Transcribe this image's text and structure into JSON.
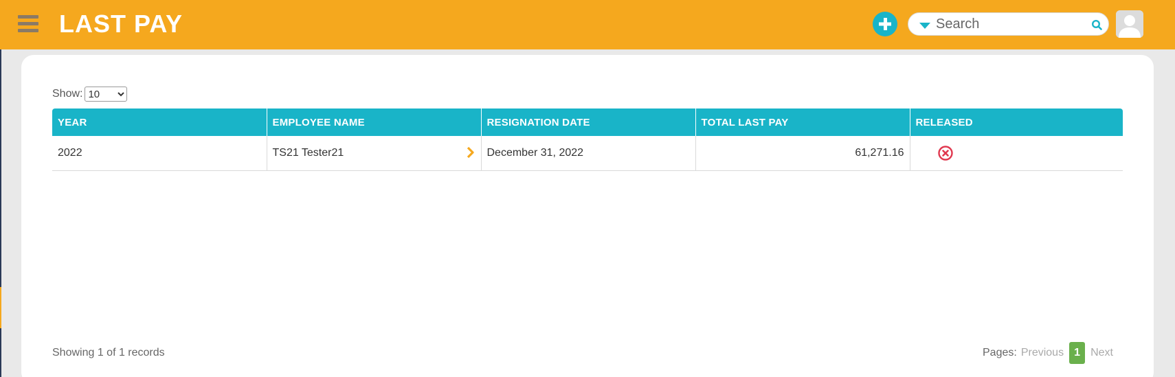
{
  "header": {
    "title": "LAST PAY",
    "search_placeholder": "Search",
    "menu_icon": "hamburger-icon",
    "add_icon": "plus-icon",
    "search_icon": "search-icon",
    "avatar_icon": "user-avatar-icon"
  },
  "controls": {
    "show_label": "Show:",
    "page_size_options": [
      "10"
    ],
    "page_size_selected": "10"
  },
  "table": {
    "columns": [
      "YEAR",
      "EMPLOYEE NAME",
      "RESIGNATION DATE",
      "TOTAL LAST PAY",
      "RELEASED"
    ],
    "rows": [
      {
        "year": "2022",
        "employee_name": "TS21 Tester21",
        "resignation_date": "December 31, 2022",
        "total_last_pay": "61,271.16",
        "released_icon": "not-released-x-icon"
      }
    ]
  },
  "footer": {
    "records_text": "Showing 1 of 1 records",
    "pages_label": "Pages:",
    "previous_label": "Previous",
    "current_page": "1",
    "next_label": "Next"
  },
  "colors": {
    "header_bg": "#f5a81e",
    "table_header_bg": "#19b4c8",
    "accent_teal": "#19b4c8",
    "released_no": "#e0384f",
    "page_active": "#6ab04c",
    "chevron": "#f5a81e"
  }
}
